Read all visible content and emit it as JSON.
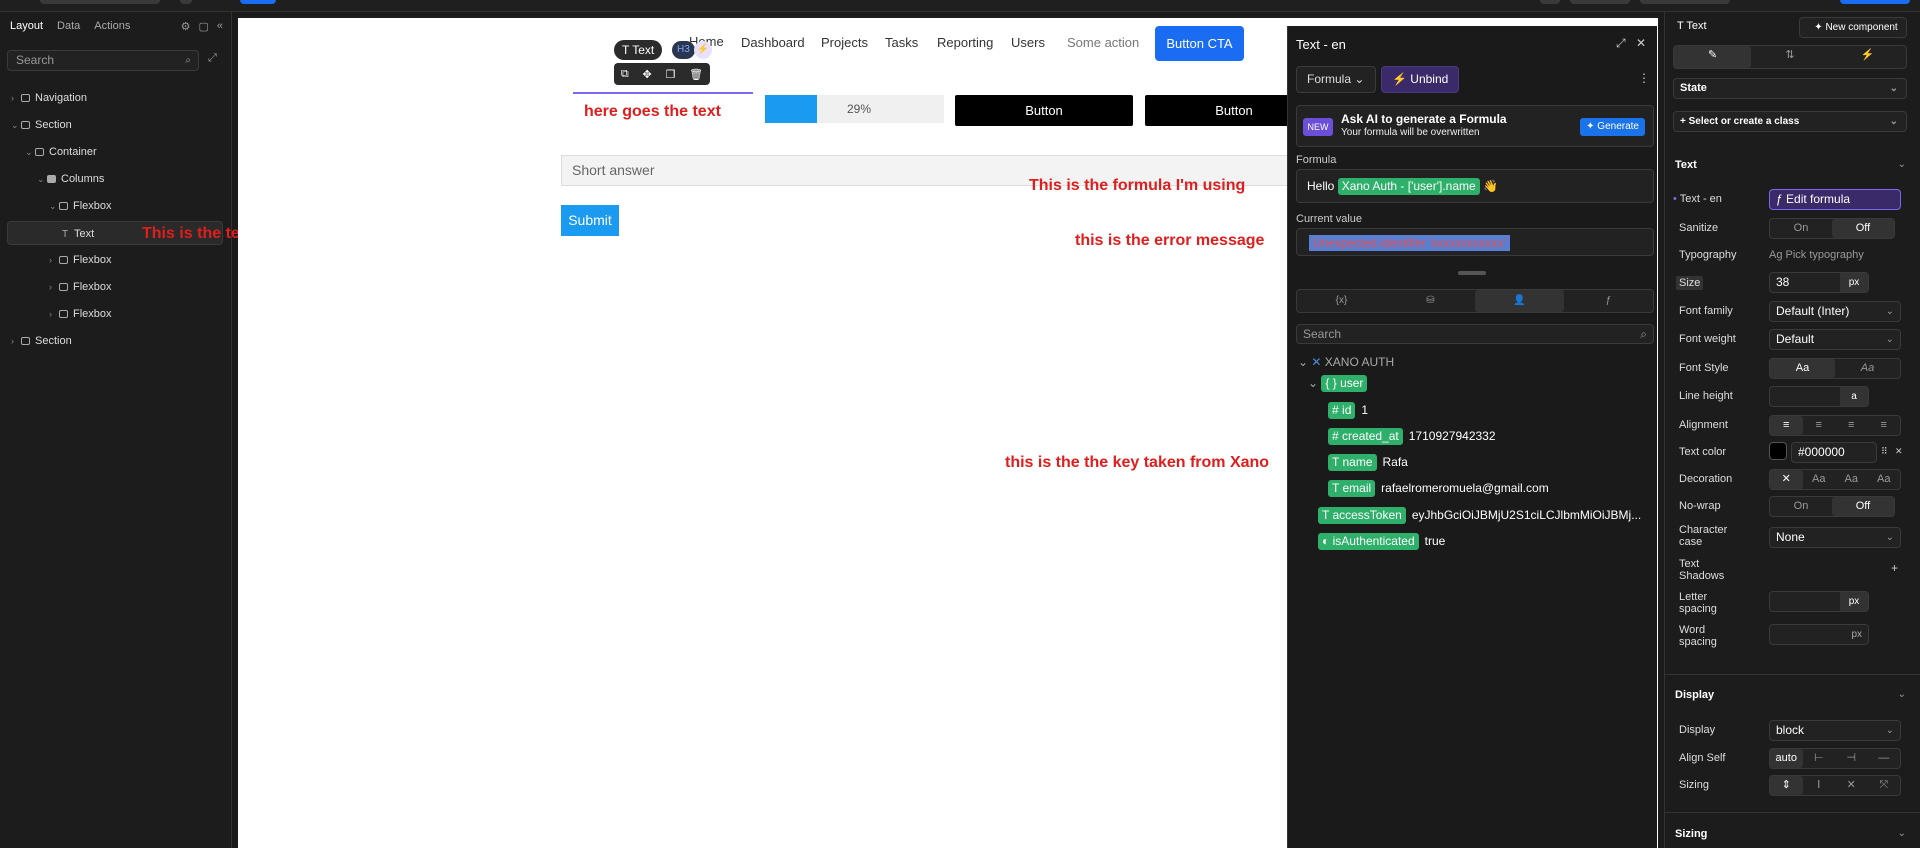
{
  "left": {
    "tabs": [
      "Layout",
      "Data",
      "Actions"
    ],
    "search_placeholder": "Search",
    "tree": [
      "Navigation",
      "Section",
      "Container",
      "Columns",
      "Flexbox",
      "Text",
      "Flexbox",
      "Flexbox",
      "Flexbox",
      "Section"
    ]
  },
  "canvas": {
    "nav": [
      "Home",
      "Dashboard",
      "Projects",
      "Tasks",
      "Reporting",
      "Users",
      "Some action"
    ],
    "cta": "Button CTA",
    "toolbar_label": "Text",
    "heading_badge": "H3",
    "progress": "29%",
    "button1": "Button",
    "button2": "Button",
    "short_answer": "Short answer",
    "submit": "Submit"
  },
  "annotations": {
    "text_here": "here goes the text",
    "text_element": "This is the text element",
    "formula": "This is the formula I'm using",
    "error": "this is the error message",
    "key": "this is the the key taken from Xano"
  },
  "formula_panel": {
    "title": "Text - en",
    "mode": "Formula",
    "unbind": "Unbind",
    "ai_new": "NEW",
    "ai_title": "Ask AI to generate a Formula",
    "ai_sub": "Your formula will be overwritten",
    "ai_generate": "Generate",
    "formula_label": "Formula",
    "formula_prefix": "Hello",
    "formula_chip": "Xano Auth - ['user'].name",
    "current_label": "Current value",
    "current_value": "Unexpected identifier 'xxxxxxxxxxxx'",
    "search_placeholder": "Search",
    "group": "XANO AUTH",
    "user": "user",
    "fields": [
      {
        "key": "id",
        "value": "1",
        "type": "#"
      },
      {
        "key": "created_at",
        "value": "1710927942332",
        "type": "#"
      },
      {
        "key": "name",
        "value": "Rafa",
        "type": "T"
      },
      {
        "key": "email",
        "value": "rafaelromeromuela@gmail.com",
        "type": "T"
      }
    ],
    "access_key": "accessToken",
    "access_value": "eyJhbGciOiJBMjU2S1ciLCJlbmMiOiJBMj...",
    "auth_key": "isAuthenticated",
    "auth_value": "true"
  },
  "right": {
    "element": "Text",
    "new_component": "New component",
    "state": "State",
    "class": "Select or create a class",
    "section_text": "Text",
    "text_en": "Text - en",
    "edit_formula": "Edit formula",
    "sanitize": "Sanitize",
    "on": "On",
    "off": "Off",
    "typography": "Typography",
    "pick_typo": "Pick typography",
    "size": "Size",
    "size_value": "38",
    "unit": "px",
    "font_family": "Font family",
    "font_family_value": "Default (Inter)",
    "font_weight": "Font weight",
    "font_weight_value": "Default",
    "font_style": "Font Style",
    "line_height": "Line height",
    "alignment": "Alignment",
    "text_color": "Text color",
    "text_color_value": "#000000",
    "decoration": "Decoration",
    "nowrap": "No-wrap",
    "char_case": "Character case",
    "char_case_value": "None",
    "shadows": "Text Shadows",
    "letter": "Letter spacing",
    "word": "Word spacing",
    "display_section": "Display",
    "display": "Display",
    "display_value": "block",
    "align_self": "Align Self",
    "align_auto": "auto",
    "sizing": "Sizing",
    "sizing_section": "Sizing"
  }
}
